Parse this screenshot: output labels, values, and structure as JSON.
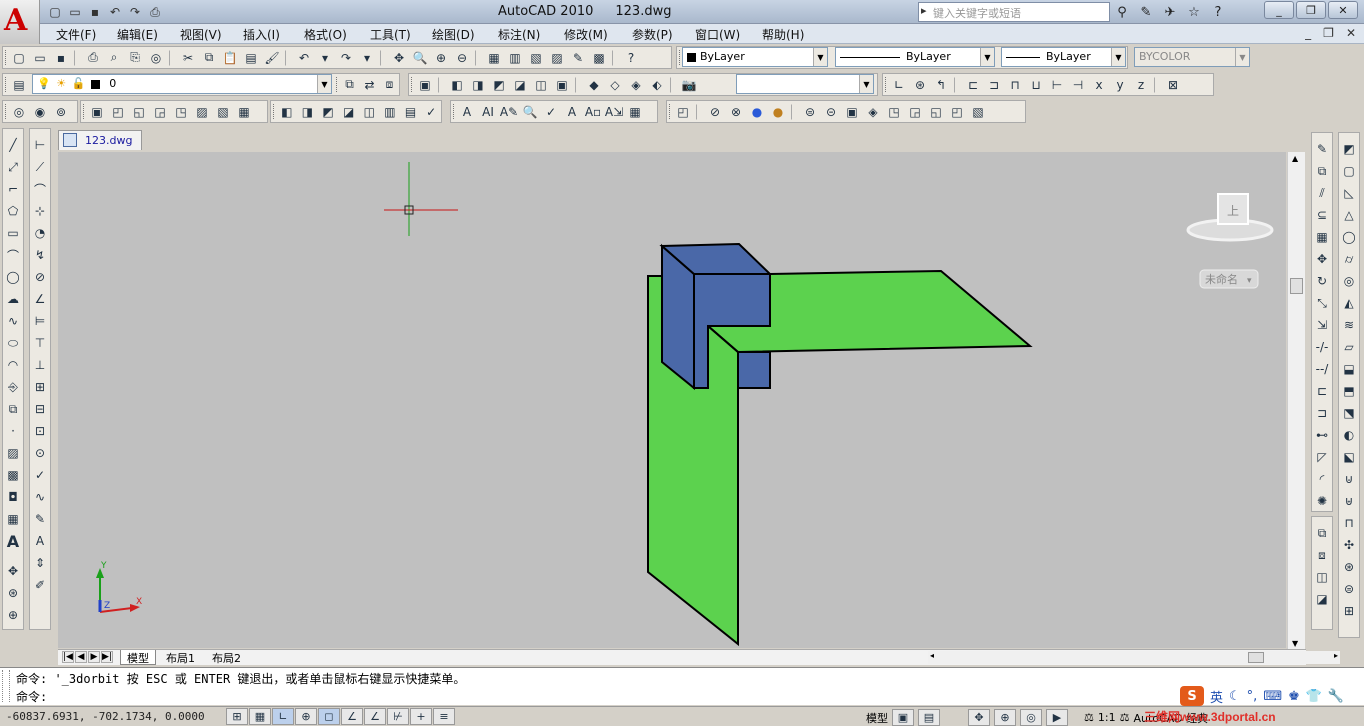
{
  "app": {
    "logo_letter": "A",
    "title": "AutoCAD 2010",
    "document": "123.dwg",
    "help_search_placeholder": "键入关键字或短语",
    "window_buttons": [
      "_",
      "❐",
      "✕"
    ]
  },
  "menu": {
    "items": [
      "文件(F)",
      "编辑(E)",
      "视图(V)",
      "插入(I)",
      "格式(O)",
      "工具(T)",
      "绘图(D)",
      "标注(N)",
      "修改(M)",
      "参数(P)",
      "窗口(W)",
      "帮助(H)"
    ],
    "mdi_buttons": [
      "_",
      "❐",
      "✕"
    ]
  },
  "properties": {
    "color": "ByLayer",
    "linetype": "ByLayer",
    "lineweight": "ByLayer",
    "plotstyle": "BYCOLOR"
  },
  "layer": {
    "current": "0"
  },
  "drawing_tab": {
    "label": "123.dwg"
  },
  "viewcube": {
    "face_label": "上",
    "named_view": "未命名"
  },
  "ucs": {
    "x_label": "X",
    "y_label": "Y",
    "z_label": "Z"
  },
  "layout_tabs": [
    "模型",
    "布局1",
    "布局2"
  ],
  "command": {
    "history": "命令: '_3dorbit 按 ESC 或 ENTER 键退出，或者单击鼠标右键显示快捷菜单。",
    "prompt": "命令:"
  },
  "status": {
    "coordinates": "-60837.6931, -702.1734, 0.0000",
    "model_label": "模型",
    "annotation_scale": "1:1",
    "workspace": "AutoCAD 经典"
  },
  "ime": {
    "logo": "S",
    "lang": "英"
  },
  "watermark": "三维网www.3dportal.cn",
  "colors": {
    "viewport_bg": "#c0c0c0",
    "green_face": "#5cd24e",
    "blue_box": "#4a68a8",
    "blue_box_side": "#3d5a98"
  }
}
